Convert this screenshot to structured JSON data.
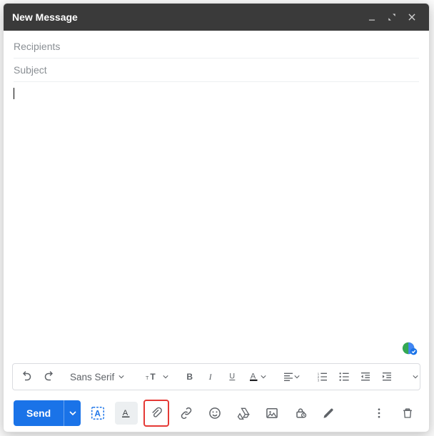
{
  "window": {
    "title": "New Message"
  },
  "fields": {
    "recipients_placeholder": "Recipients",
    "recipients_value": "",
    "subject_placeholder": "Subject",
    "subject_value": ""
  },
  "body": {
    "content": ""
  },
  "format_toolbar": {
    "font_family": "Sans Serif"
  },
  "actions": {
    "send_label": "Send"
  }
}
